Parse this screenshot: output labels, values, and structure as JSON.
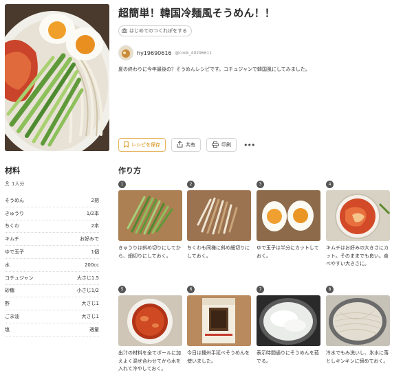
{
  "recipe": {
    "title": "超簡単！韓国冷麺風そうめん！！",
    "tsukurepo_label": "はじめてのつくれぽをする",
    "author_name": "hy19690616",
    "author_id": "@cook_40296611",
    "description": "夏の終わりに今年最後の？そうめんレシピです。コチュジャンで韓国風にしてみました。"
  },
  "actions": {
    "save_label": "レシピを保存",
    "share_label": "共有",
    "print_label": "印刷",
    "more_label": "•••"
  },
  "ingredients": {
    "heading": "材料",
    "servings": "1人分",
    "items": [
      {
        "name": "そうめん",
        "amount": "2把"
      },
      {
        "name": "きゅうり",
        "amount": "1/2本"
      },
      {
        "name": "ちくわ",
        "amount": "2本"
      },
      {
        "name": "キムチ",
        "amount": "お好みで"
      },
      {
        "name": "ゆで玉子",
        "amount": "1個"
      },
      {
        "name": "水",
        "amount": "200cc"
      },
      {
        "name": "コチュジャン",
        "amount": "大さじ1.5"
      },
      {
        "name": "砂糖",
        "amount": "小さじ1/2"
      },
      {
        "name": "酢",
        "amount": "大さじ1"
      },
      {
        "name": "ごま油",
        "amount": "大さじ1"
      },
      {
        "name": "塩",
        "amount": "適量"
      }
    ]
  },
  "steps": {
    "heading": "作り方",
    "items": [
      {
        "num": "1",
        "text": "きゅうりは斜め切りにしてから、細切りにしておく。"
      },
      {
        "num": "2",
        "text": "ちくわも同様に斜め細切りにしておく。"
      },
      {
        "num": "3",
        "text": "ゆで玉子は半分にカットしておく。"
      },
      {
        "num": "4",
        "text": "キムチはお好みの大きさにカット。そのままでも良い。食べやすい大きさに。"
      },
      {
        "num": "5",
        "text": "出汁の材料を全てボールに加えよく混ぜ合わせてから水を入れて冷やしておく。"
      },
      {
        "num": "6",
        "text": "今日は播州手延べそうめんを使いました。"
      },
      {
        "num": "7",
        "text": "表示時間通りにそうめんを茹でる。"
      },
      {
        "num": "8",
        "text": "冷水でもみ洗いし、氷水に落としキンキンに締めておく。"
      }
    ]
  },
  "colors": {
    "accent": "#d58a00",
    "step_badge": "#555555"
  }
}
